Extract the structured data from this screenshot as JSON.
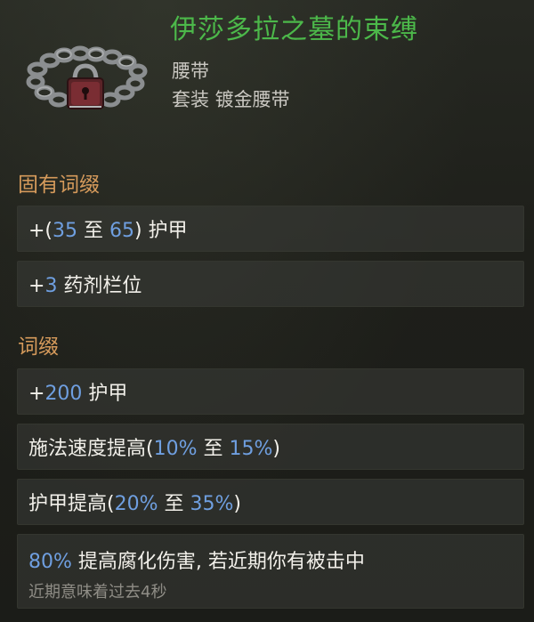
{
  "item": {
    "name": "伊莎多拉之墓的束缚",
    "type": "腰带",
    "base": "套装 镀金腰带",
    "icon": "chain-belt-with-lock-icon"
  },
  "sections": {
    "implicit_title": "固有词缀",
    "explicit_title": "词缀"
  },
  "implicit": [
    {
      "pre": "+(",
      "n1": "35",
      "mid": " 至 ",
      "n2": "65",
      "post": ") 护甲"
    },
    {
      "pre": "+",
      "n1": "3",
      "post": " 药剂栏位"
    }
  ],
  "explicit": [
    {
      "pre": "+",
      "n1": "200",
      "post": " 护甲"
    },
    {
      "pre": "施法速度提高(",
      "n1": "10%",
      "mid": " 至 ",
      "n2": "15%",
      "post": ")"
    },
    {
      "pre": "护甲提高(",
      "n1": "20%",
      "mid": " 至 ",
      "n2": "35%",
      "post": ")"
    },
    {
      "n1": "80%",
      "post": " 提高腐化伤害, 若近期你有被击中",
      "sub": "近期意味着过去4秒"
    }
  ],
  "colors": {
    "name": "#4cb84a",
    "section": "#d59a5b",
    "value": "#6f9fe0"
  }
}
